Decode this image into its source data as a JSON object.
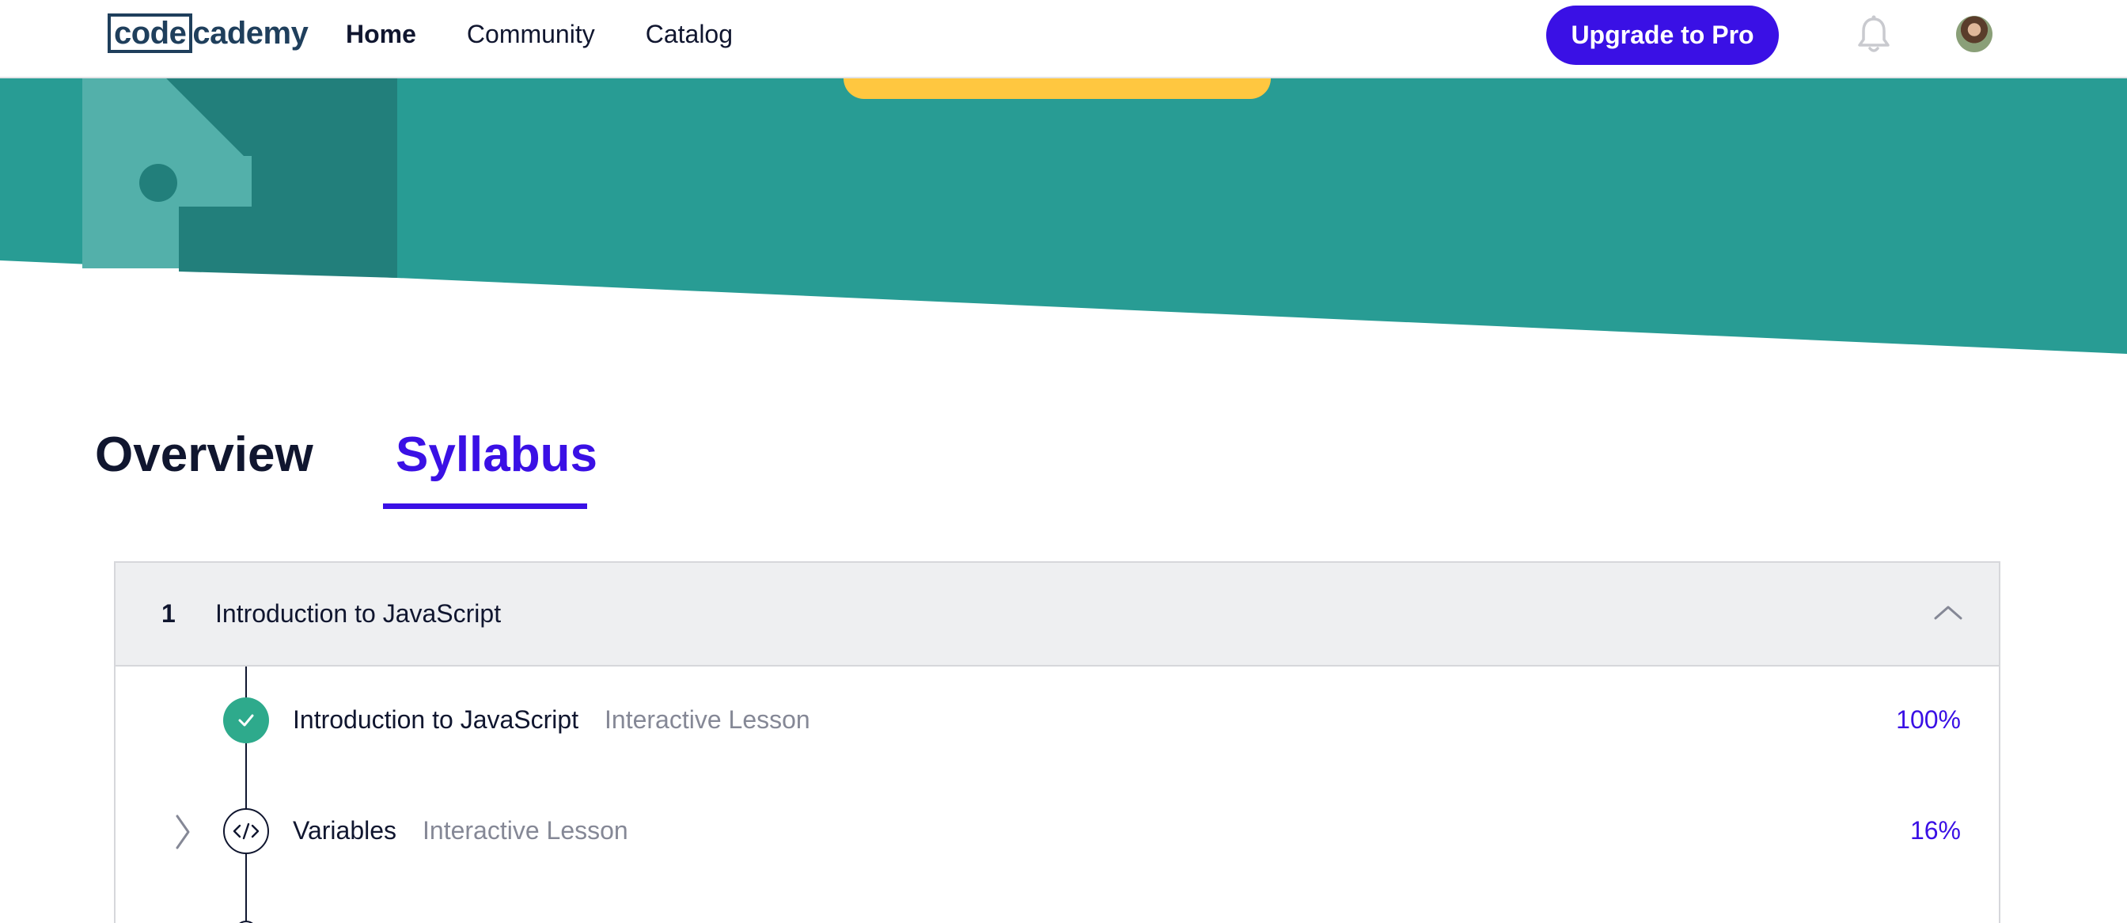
{
  "nav": {
    "logo_boxed": "code",
    "logo_rest": "cademy",
    "links": [
      {
        "label": "Home",
        "active": true
      },
      {
        "label": "Community",
        "active": false
      },
      {
        "label": "Catalog",
        "active": false
      }
    ],
    "upgrade_label": "Upgrade to Pro",
    "icons": {
      "bell": "bell-icon",
      "avatar": "user-avatar"
    }
  },
  "colors": {
    "brand": "#3a10e5",
    "hero_teal": "#289c94",
    "cta_yellow": "#ffc740",
    "success": "#2eaa8c"
  },
  "tabs": [
    {
      "label": "Overview",
      "active": false
    },
    {
      "label": "Syllabus",
      "active": true
    }
  ],
  "syllabus": {
    "module": {
      "number": "1",
      "title": "Introduction to JavaScript",
      "expanded": true,
      "chevron_icon": "chevron-up-icon"
    },
    "lessons": [
      {
        "title": "Introduction to JavaScript",
        "type": "Interactive Lesson",
        "progress": "100%",
        "status_icon": "checkmark-icon"
      },
      {
        "title": "Variables",
        "type": "Interactive Lesson",
        "progress": "16%",
        "status_icon": "code-icon",
        "expand_icon": "chevron-right-icon"
      }
    ]
  }
}
